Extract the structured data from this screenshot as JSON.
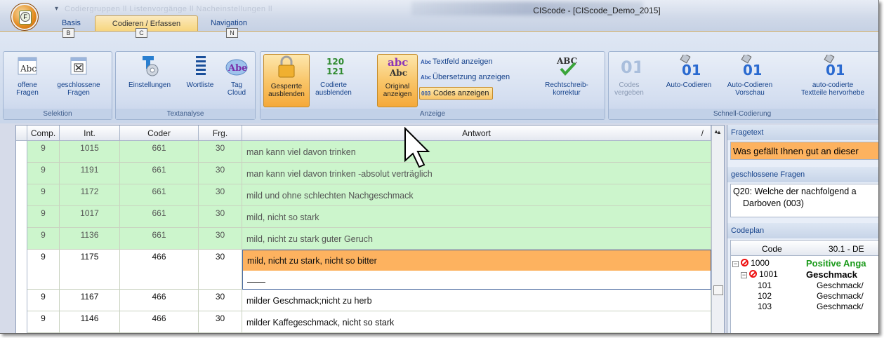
{
  "window": {
    "title": "CIScode - [CIScode_Demo_2015]",
    "qat_arrow": "▾",
    "qat_blurred": "Codiergruppen ll  Listenvorgänge ll  Nacheinstellungen ll"
  },
  "app_menu": {
    "letter": "F"
  },
  "ribbon": {
    "tabs": [
      {
        "label": "Basis",
        "keytip": "B"
      },
      {
        "label": "Codieren / Erfassen",
        "keytip": "C"
      },
      {
        "label": "Navigation",
        "keytip": "N"
      }
    ],
    "groups": {
      "selektion": {
        "label": "Selektion",
        "buttons": [
          {
            "label1": "offene",
            "label2": "Fragen",
            "icon": "open-questions-icon"
          },
          {
            "label1": "geschlossene",
            "label2": "Fragen",
            "icon": "closed-questions-icon"
          }
        ]
      },
      "textanalyse": {
        "label": "Textanalyse",
        "buttons": [
          {
            "label1": "Einstellungen",
            "label2": "",
            "icon": "settings-icon"
          },
          {
            "label1": "Wortliste",
            "label2": "",
            "icon": "word-list-icon"
          },
          {
            "label1": "Tag",
            "label2": "Cloud",
            "icon": "tag-cloud-icon"
          }
        ]
      },
      "anzeige": {
        "label": "Anzeige",
        "buttons": [
          {
            "label1": "Gesperrte",
            "label2": "ausblenden",
            "icon": "lock-icon",
            "selected": true
          },
          {
            "label1": "Codierte",
            "label2": "ausblenden",
            "icon": "coded-icon",
            "selected": false
          },
          {
            "label1": "Original",
            "label2": "anzeigen",
            "icon": "abc-original-icon",
            "selected": true
          }
        ],
        "small_buttons": [
          {
            "label": "Textfeld anzeigen",
            "icon_text": "Abc"
          },
          {
            "label": "Übersetzung anzeigen",
            "icon_text": "Abc"
          },
          {
            "label": "Codes anzeigen",
            "icon_text": "003"
          }
        ],
        "spell": {
          "label1": "Rechtschreib-",
          "label2": "korrektur",
          "icon_text": "ABC"
        }
      },
      "schnell": {
        "label": "Schnell-Codierung",
        "buttons": [
          {
            "label1": "Codes",
            "label2": "vergeben",
            "icon": "codes-icon",
            "disabled": true
          },
          {
            "label1": "Auto-Codieren",
            "label2": "",
            "icon": "auto-code-icon"
          },
          {
            "label1": "Auto-Codieren",
            "label2": "Vorschau",
            "icon": "auto-code-preview-icon"
          },
          {
            "label1": "auto-codierte",
            "label2": "Textteile hervorhebe",
            "icon": "highlight-icon"
          }
        ]
      }
    }
  },
  "grid": {
    "headers": [
      "Comp.",
      "Int.",
      "Coder",
      "Frg.",
      "Antwort"
    ],
    "sort_marker": "/",
    "rows": [
      {
        "comp": "9",
        "int": "1015",
        "coder": "661",
        "frg": "30",
        "antwort": "man kann viel davon trinken",
        "state": "green"
      },
      {
        "comp": "9",
        "int": "1191",
        "coder": "661",
        "frg": "30",
        "antwort": "man kann viel davon trinken -absolut verträglich",
        "state": "green"
      },
      {
        "comp": "9",
        "int": "1172",
        "coder": "661",
        "frg": "30",
        "antwort": "mild und ohne schlechten Nachgeschmack",
        "state": "green"
      },
      {
        "comp": "9",
        "int": "1017",
        "coder": "661",
        "frg": "30",
        "antwort": "mild, nicht so stark",
        "state": "green"
      },
      {
        "comp": "9",
        "int": "1136",
        "coder": "661",
        "frg": "30",
        "antwort": "mild, nicht zu stark guter Geruch",
        "state": "green"
      },
      {
        "comp": "9",
        "int": "1175",
        "coder": "466",
        "frg": "30",
        "antwort": "mild, nicht zu stark, nicht so bitter",
        "state": "edit"
      },
      {
        "comp": "9",
        "int": "1167",
        "coder": "466",
        "frg": "30",
        "antwort": "milder Geschmack;nicht zu herb",
        "state": "white"
      },
      {
        "comp": "9",
        "int": "1146",
        "coder": "466",
        "frg": "30",
        "antwort": "milder Kaffegeschmack, nicht so stark",
        "state": "white"
      }
    ]
  },
  "right_pane": {
    "fragetext_title": "Fragetext",
    "fragetext": "Was gefällt Ihnen gut an dieser",
    "geschlossene_title": "geschlossene Fragen",
    "geschlossene_line1": "Q20: Welche der nachfolgend a",
    "geschlossene_line2": "Darboven (003)",
    "codeplan_title": "Codeplan",
    "codeplan_headers": [
      "Code",
      "30.1 - DE"
    ],
    "tree": [
      {
        "code": "1000",
        "label": "Positive Anga",
        "level": 0,
        "blocked": true,
        "expander": "-"
      },
      {
        "code": "1001",
        "label": "Geschmack",
        "level": 1,
        "blocked": true,
        "expander": "-"
      },
      {
        "code": "101",
        "label": "Geschmack/",
        "level": 2
      },
      {
        "code": "102",
        "label": "Geschmack/",
        "level": 2
      },
      {
        "code": "103",
        "label": "Geschmack/",
        "level": 2
      }
    ]
  },
  "colors": {
    "green_row": "#ccf5cc",
    "edit_row": "#fdb25f",
    "fragetext_bg": "#fdb25f",
    "positive_label": "#1a9a1a"
  }
}
